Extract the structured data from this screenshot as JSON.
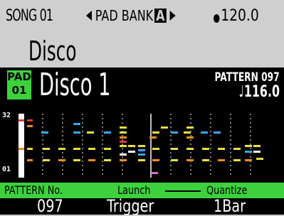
{
  "header": {
    "song_label": "SONG 01",
    "bank_label": "PAD BANK",
    "bank_letter": "A",
    "tempo": "120.0"
  },
  "kit": {
    "name": "Disco"
  },
  "pad": {
    "badge_line1": "PAD",
    "badge_line2": "01",
    "name": "Disco 1",
    "pattern_label": "PATTERN 097",
    "pattern_tempo": "116.0"
  },
  "grid": {
    "top_label": "32",
    "bottom_label": "01",
    "colors": {
      "blue": "#3aa7e6",
      "yellow": "#e6e23a",
      "orange": "#f28a1e",
      "pink": "#e46ad6",
      "red": "#e23a3a",
      "white": "#ffffff",
      "green": "#3dd23d"
    }
  },
  "bottom": {
    "col1_label": "PATTERN No.",
    "col2_label": "Launch",
    "col3_label": "Quantize",
    "col1_value": "097",
    "col2_value": "Trigger",
    "col3_value": "1Bar"
  }
}
